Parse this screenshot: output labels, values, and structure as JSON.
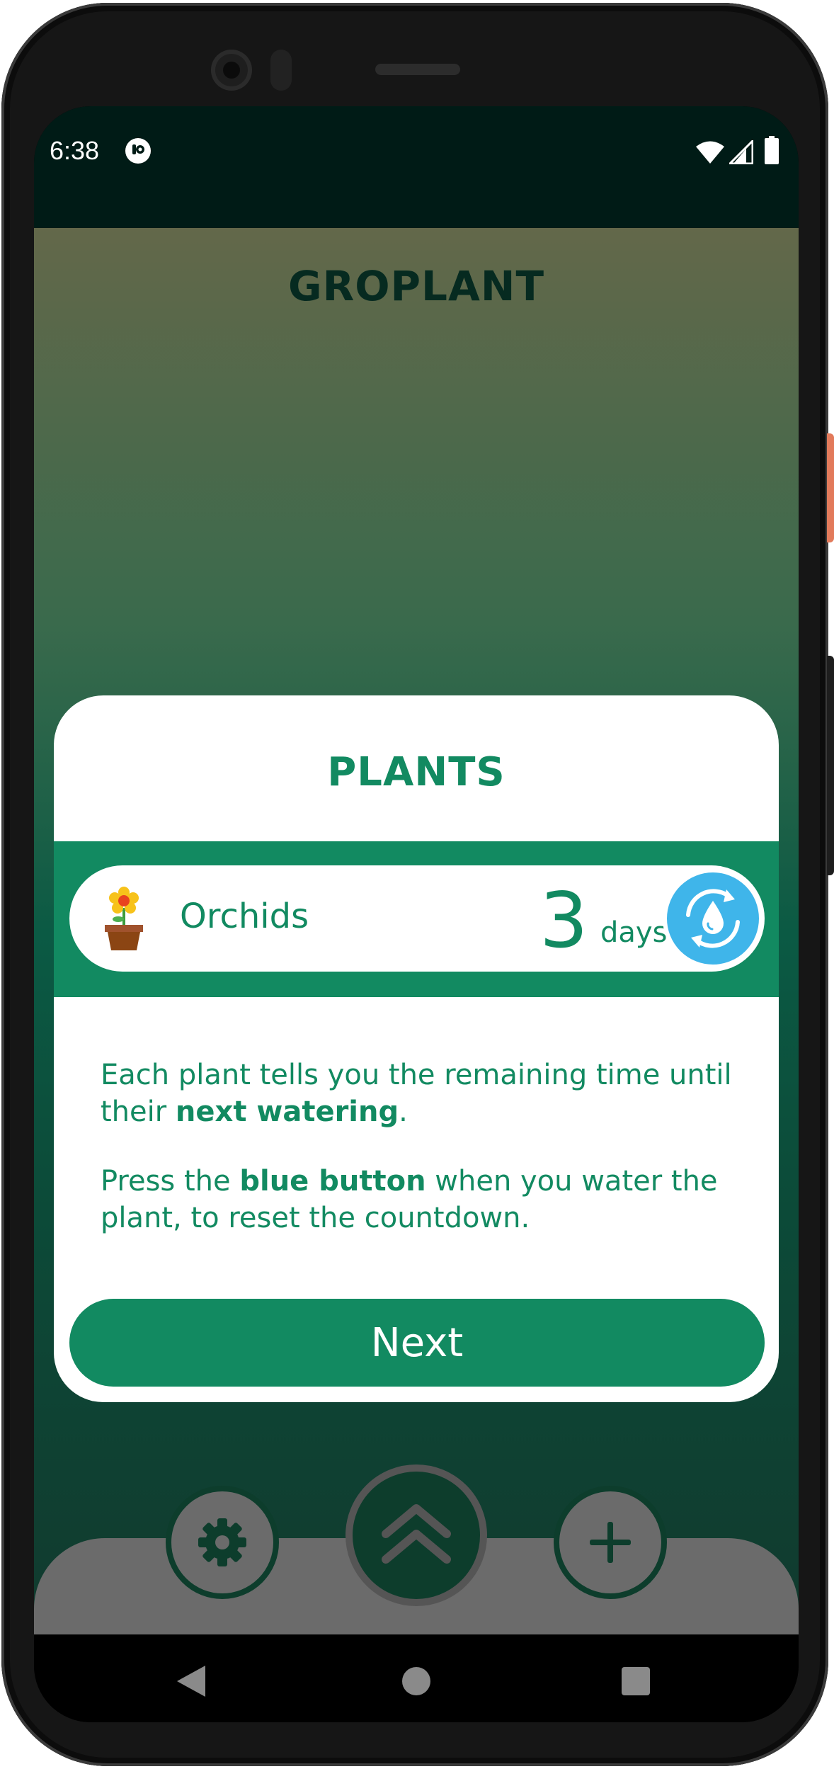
{
  "status_bar": {
    "time": "6:38",
    "icons": [
      "notification-icon",
      "wifi-icon",
      "signal-icon",
      "battery-icon"
    ]
  },
  "app": {
    "title": "GROPLANT"
  },
  "modal": {
    "title": "PLANTS",
    "demo_plant": {
      "name": "Orchids",
      "days_value": "3",
      "days_label": "days",
      "icon": "flower-pot-icon",
      "action_icon": "water-reset-icon"
    },
    "paragraph1": {
      "part1": "Each plant tells you the remaining time until their ",
      "bold": "next watering",
      "part2": "."
    },
    "paragraph2": {
      "part1": "Press the ",
      "bold": "blue button",
      "part2": " when you water the plant, to reset the countdown."
    },
    "next_label": "Next"
  },
  "bottom_nav": {
    "items": [
      "settings-gear-icon",
      "expand-up-icon",
      "add-plus-icon"
    ]
  },
  "colors": {
    "primary_green": "#128a61",
    "water_blue": "#3fb5ea",
    "dark_green": "#0d3d2c",
    "status_bar": "#001b16"
  }
}
